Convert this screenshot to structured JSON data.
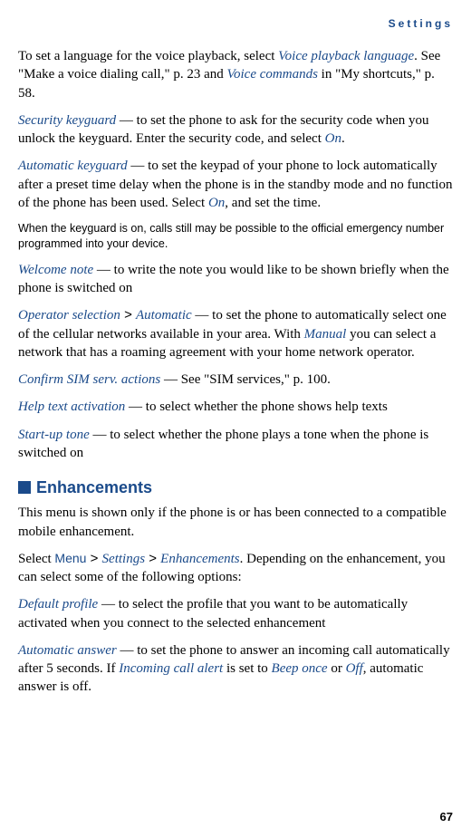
{
  "header": "Settings",
  "p1": {
    "t1": "To set a language for the voice playback, select ",
    "link1": "Voice playback language",
    "t2": ". See \"Make a voice dialing call,\" p. 23 and ",
    "link2": "Voice commands",
    "t3": " in \"My shortcuts,\" p. 58."
  },
  "p2": {
    "term": "Security keyguard",
    "t1": " — to set the phone to ask for the security code when you unlock the keyguard. Enter the security code, and select ",
    "link1": "On",
    "t2": "."
  },
  "p3": {
    "term": "Automatic keyguard",
    "t1": " — to set the keypad of your phone to lock automatically after a preset time delay when the phone is in the standby mode and no function of the phone has been used. Select ",
    "link1": "On",
    "t2": ", and set the time."
  },
  "p4": "When the keyguard is on, calls still may be possible to the official emergency number programmed into your device.",
  "p5": {
    "term": "Welcome note",
    "t1": " — to write the note you would like to be shown briefly when the phone is switched on"
  },
  "p6": {
    "term": "Operator selection",
    "gt": " > ",
    "term2": "Automatic",
    "t1": " — to set the phone to automatically select one of the cellular networks available in your area. With ",
    "link1": "Manual",
    "t2": " you can select a network that has a roaming agreement with your home network operator."
  },
  "p7": {
    "term": "Confirm SIM serv. actions",
    "t1": " — See \"SIM services,\" p. 100."
  },
  "p8": {
    "term": "Help text activation",
    "t1": " — to select whether the phone shows help texts"
  },
  "p9": {
    "term": "Start-up tone",
    "t1": " — to select whether the phone plays a tone when the phone is switched on"
  },
  "section_heading": "Enhancements",
  "p10": "This menu is shown only if the phone is or has been connected to a compatible mobile enhancement.",
  "p11": {
    "t1": "Select ",
    "link1": "Menu",
    "gt1": " > ",
    "link2": "Settings",
    "gt2": " > ",
    "link3": "Enhancements",
    "t2": ". Depending on the enhancement, you can select some of the following options:"
  },
  "p12": {
    "term": "Default profile",
    "t1": " — to select the profile that you want to be automatically activated when you connect to the selected enhancement"
  },
  "p13": {
    "term": "Automatic answer",
    "t1": " — to set the phone to answer an incoming call automatically after 5 seconds. If ",
    "link1": "Incoming call alert",
    "t2": " is set to ",
    "link2": "Beep once",
    "t3": " or ",
    "link3": "Off",
    "t4": ", automatic answer is off."
  },
  "page_number": "67"
}
